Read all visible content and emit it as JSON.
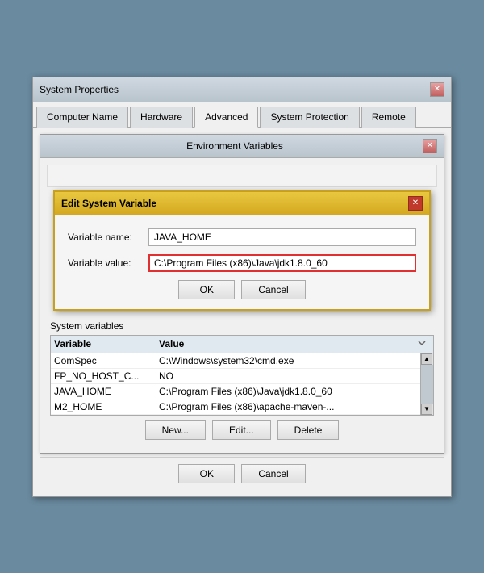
{
  "window": {
    "title": "System Properties",
    "close_label": "✕"
  },
  "tabs": [
    {
      "id": "computer-name",
      "label": "Computer Name"
    },
    {
      "id": "hardware",
      "label": "Hardware"
    },
    {
      "id": "advanced",
      "label": "Advanced",
      "active": true
    },
    {
      "id": "system-protection",
      "label": "System Protection"
    },
    {
      "id": "remote",
      "label": "Remote"
    }
  ],
  "env_window": {
    "title": "Environment Variables",
    "close_label": "✕"
  },
  "edit_dialog": {
    "title": "Edit System Variable",
    "close_label": "✕",
    "variable_name_label": "Variable name:",
    "variable_value_label": "Variable value:",
    "variable_name_value": "JAVA_HOME",
    "variable_value_value": "C:\\Program Files (x86)\\Java\\jdk1.8.0_60",
    "ok_label": "OK",
    "cancel_label": "Cancel"
  },
  "system_variables": {
    "section_label": "System variables",
    "col_variable": "Variable",
    "col_value": "Value",
    "rows": [
      {
        "variable": "ComSpec",
        "value": "C:\\Windows\\system32\\cmd.exe"
      },
      {
        "variable": "FP_NO_HOST_C...",
        "value": "NO"
      },
      {
        "variable": "JAVA_HOME",
        "value": "C:\\Program Files (x86)\\Java\\jdk1.8.0_60"
      },
      {
        "variable": "M2_HOME",
        "value": "C:\\Program Files (x86)\\apache-maven-..."
      }
    ],
    "new_label": "New...",
    "edit_label": "Edit...",
    "delete_label": "Delete"
  },
  "bottom_buttons": {
    "ok_label": "OK",
    "cancel_label": "Cancel"
  }
}
